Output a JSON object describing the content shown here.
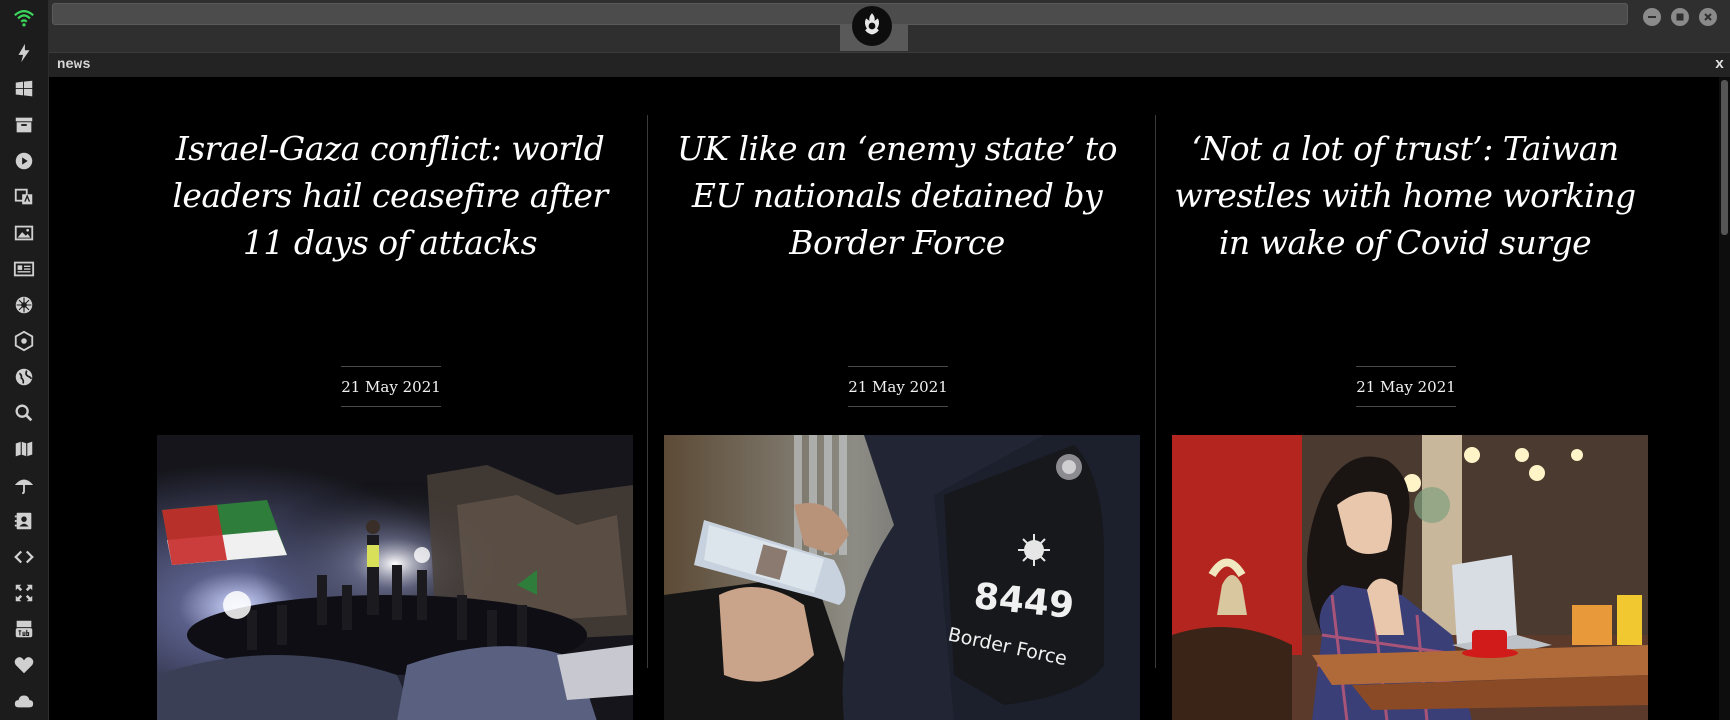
{
  "pane": {
    "title": "news",
    "close_label": "x"
  },
  "dock": {
    "items": [
      "wifi-icon",
      "lightning-icon",
      "windows-icon",
      "archive-icon",
      "play-icon",
      "translate-icon",
      "image-icon",
      "newspaper-icon",
      "rebel-icon",
      "atom-icon",
      "globe-icon",
      "search-icon",
      "map-icon",
      "umbrella-icon",
      "contacts-icon",
      "code-icon",
      "expand-icon",
      "youtube-icon",
      "heart-icon",
      "cloud-icon"
    ]
  },
  "articles": [
    {
      "headline": "Israel-Gaza conflict: world leaders hail ceasefire after 11 days of attacks",
      "date": "21 May 2021",
      "image": "crowd celebrating at night with flag"
    },
    {
      "headline": "UK like an ‘enemy state’ to EU nationals detained by Border Force",
      "date": "21 May 2021",
      "image": "border force officer checking passport"
    },
    {
      "headline": "‘Not a lot of trust’: Taiwan wrestles with home working in wake of Covid surge",
      "date": "21 May 2021",
      "image": "woman working on laptop in cafe"
    }
  ],
  "photo_text": {
    "epaulette_number": "8449",
    "epaulette_label": "Border Force"
  }
}
